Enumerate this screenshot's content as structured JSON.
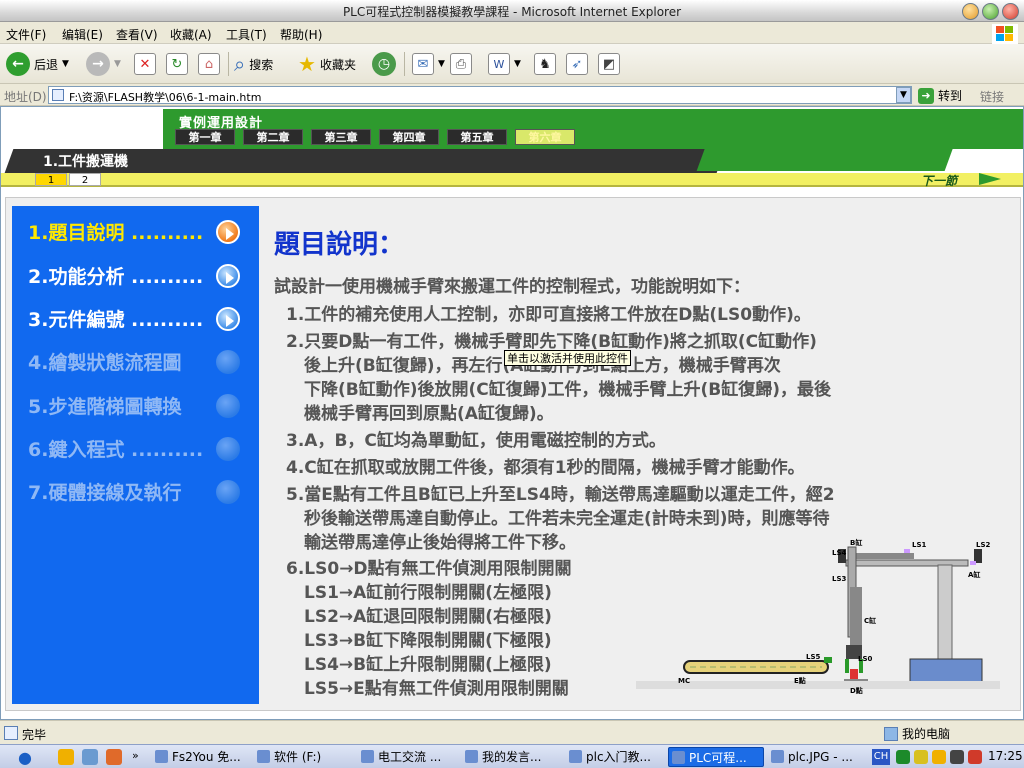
{
  "window": {
    "title": "PLC可程式控制器模擬教學課程 - Microsoft Internet Explorer"
  },
  "menu": [
    "文件(F)",
    "编辑(E)",
    "查看(V)",
    "收藏(A)",
    "工具(T)",
    "帮助(H)"
  ],
  "toolbar": {
    "back": "后退",
    "search": "搜索",
    "favorites": "收藏夹"
  },
  "address": {
    "label": "地址(D)",
    "url": "F:\\资源\\FLASH教学\\06\\6-1-main.htm",
    "go": "转到",
    "links": "链接"
  },
  "banner": {
    "title": "實例運用設計",
    "chapters": [
      "第一章",
      "第二章",
      "第三章",
      "第四章",
      "第五章",
      "第六章"
    ],
    "active_chapter": 5,
    "section": "1.工件搬運機",
    "subtabs": [
      "1",
      "2"
    ],
    "next": "下一節"
  },
  "sidebar": {
    "items": [
      {
        "label": "1.題目說明 ..........",
        "state": "active"
      },
      {
        "label": "2.功能分析 ..........",
        "state": "enabled"
      },
      {
        "label": "3.元件編號 ..........",
        "state": "enabled"
      },
      {
        "label": "4.繪製狀態流程圖",
        "state": "disabled"
      },
      {
        "label": "5.步進階梯圖轉換",
        "state": "disabled"
      },
      {
        "label": "6.鍵入程式 ..........",
        "state": "disabled"
      },
      {
        "label": "7.硬體接線及執行",
        "state": "disabled"
      }
    ]
  },
  "main": {
    "title": "題目說明：",
    "intro": "試設計一使用機械手臂來搬運工件的控制程式，功能說明如下：",
    "lines": [
      "1.工件的補充使用人工控制，亦即可直接將工件放在D點(LS0動作)。",
      "2.只要D點一有工件，機械手臂即先下降(B缸動作)將之抓取(C缸動作)",
      "後上升(B缸復歸)，再左行(A缸動作)到E點上方，機械手臂再次",
      "下降(B缸動作)後放開(C缸復歸)工件，機械手臂上升(B缸復歸)，最後",
      "機械手臂再回到原點(A缸復歸)。",
      "3.A，B，C缸均為單動缸，使用電磁控制的方式。",
      "4.C缸在抓取或放開工件後，都須有1秒的間隔，機械手臂才能動作。",
      "5.當E點有工件且B缸已上升至LS4時，輸送帶馬達驅動以運走工件，經2",
      "秒後輸送帶馬達自動停止。工件若未完全運走(計時未到)時，則應等待",
      "輸送帶馬達停止後始得將工件下移。",
      "6.LS0→D點有無工件偵測用限制開關",
      "LS1→A缸前行限制開關(左極限)",
      "LS2→A缸退回限制開關(右極限)",
      "LS3→B缸下降限制開關(下極限)",
      "LS4→B缸上升限制開關(上極限)",
      "LS5→E點有無工件偵測用限制開關"
    ],
    "tooltip": "单击以激活并使用此控件"
  },
  "diagram": {
    "labels": {
      "b": "B缸",
      "a": "A缸",
      "c": "C缸",
      "ls0": "LS0",
      "ls1": "LS1",
      "ls2": "LS2",
      "ls3": "LS3",
      "ls4": "LS4",
      "ls5": "LS5",
      "mc": "MC",
      "e": "E點",
      "d": "D點"
    }
  },
  "status": {
    "text": "完毕",
    "zone": "我的电脑"
  },
  "taskbar": {
    "tasks": [
      {
        "label": "Fs2You 免...",
        "active": false
      },
      {
        "label": "软件 (F:)",
        "active": false
      },
      {
        "label": "电工交流 ...",
        "active": false
      },
      {
        "label": "我的发言...",
        "active": false
      },
      {
        "label": "plc入门教...",
        "active": false
      },
      {
        "label": "PLC可程...",
        "active": true
      },
      {
        "label": "plc.JPG - ...",
        "active": false
      }
    ],
    "ime": "CH",
    "clock": "17:25"
  },
  "colors": {
    "sidebar": "#1169ef",
    "title_blue": "#1234cc",
    "banner_green": "#2e9a2e",
    "active_item": "#ffe800"
  }
}
